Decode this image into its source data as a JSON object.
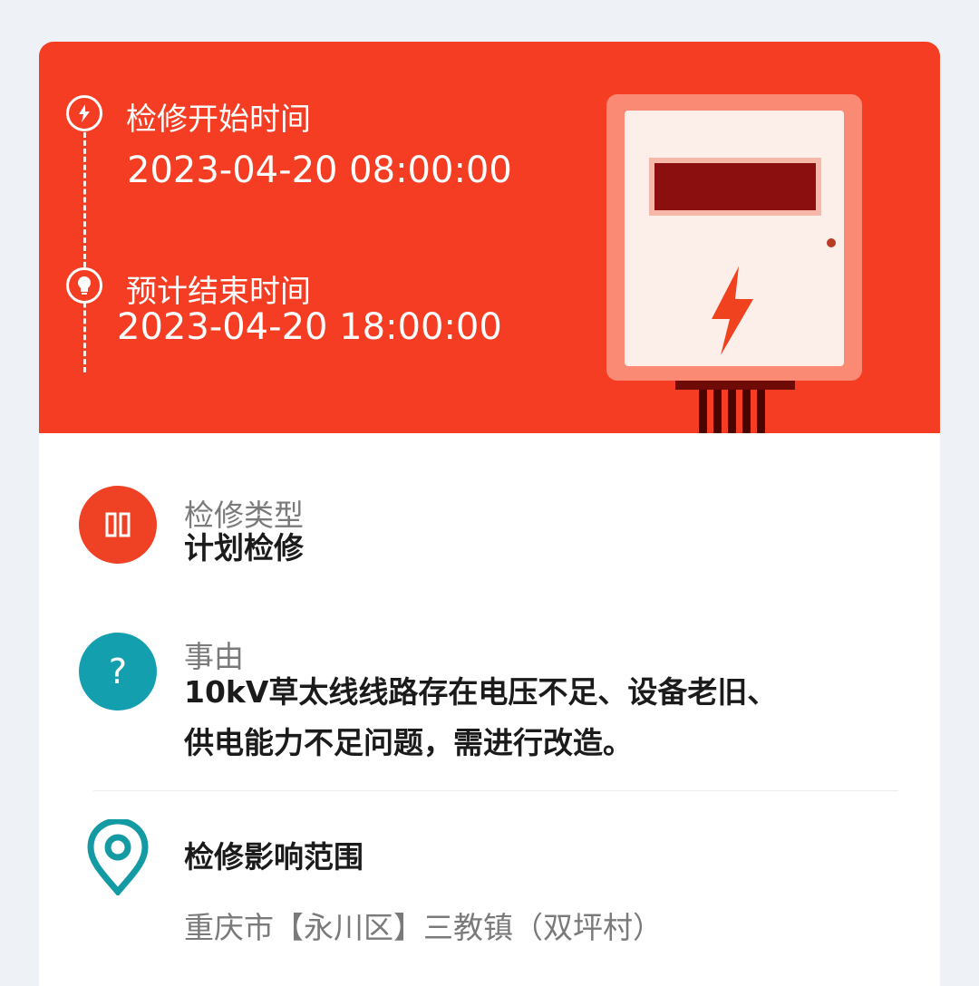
{
  "maintenance": {
    "start_label": "检修开始时间",
    "start_time": "2023-04-20 08:00:00",
    "end_label": "预计结束时间",
    "end_time": "2023-04-20 18:00:00"
  },
  "details": {
    "type_label": "检修类型",
    "type_value": "计划检修",
    "reason_label": "事由",
    "reason_line1": "10kV草太线线路存在电压不足、设备老旧、",
    "reason_line2": "供电能力不足问题，需进行改造。",
    "scope_label": "检修影响范围",
    "scope_value": "重庆市【永川区】三教镇（双坪村）"
  },
  "icons": {
    "start": "lightning-icon",
    "end": "lightbulb-icon",
    "meter": "electric-meter-icon",
    "type": "pause-icon",
    "reason": "question-icon",
    "scope": "location-pin-icon"
  },
  "colors": {
    "hero": "#f43d22",
    "type_icon": "#ef4124",
    "reason_icon": "#139fae",
    "scope_icon": "#149aa3"
  }
}
